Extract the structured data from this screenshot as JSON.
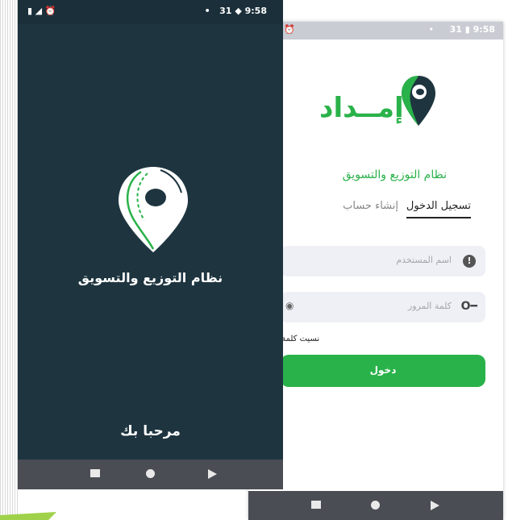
{
  "colors": {
    "brand_green": "#2ab24a",
    "splash_bg": "#1e3540",
    "nav_bar": "#4a4d54"
  },
  "back_phone": {
    "status_bar": {
      "time": "9:58",
      "calendar": "31",
      "alarm_icon": "alarm-icon"
    },
    "logo_text": "إمــداد",
    "app_title": "نظام التوزيع والتسويق",
    "tabs": {
      "login": "تسجيل الدخول",
      "register": "إنشاء حساب"
    },
    "username": {
      "placeholder": "اسم المستخدم",
      "icon": "info-icon"
    },
    "password": {
      "placeholder": "كلمة المرور",
      "icon": "key-icon",
      "toggle_icon": "eye-icon"
    },
    "forgot_password": "نسيت كلمة ال",
    "login_button": "دخول"
  },
  "front_phone": {
    "status_bar": {
      "time": "9:58",
      "calendar": "31"
    },
    "app_title": "نظام التوزيع والتسويق",
    "welcome": "مرحبا بك"
  }
}
